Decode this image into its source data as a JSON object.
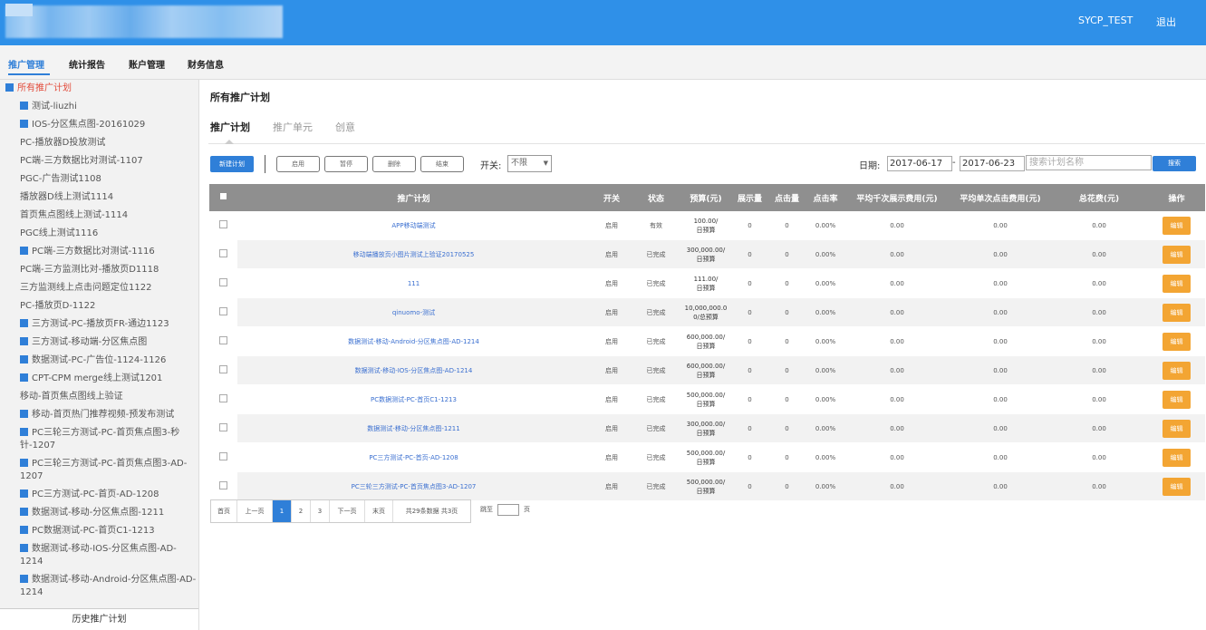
{
  "header": {
    "user": "SYCP_TEST",
    "logout": "退出"
  },
  "nav": [
    "推广管理",
    "统计报告",
    "账户管理",
    "财务信息"
  ],
  "sidebar": {
    "root": "所有推广计划",
    "items": [
      {
        "label": "测试-liuzhi",
        "icon": true
      },
      {
        "label": "IOS-分区焦点图-20161029",
        "icon": true
      },
      {
        "label": "PC-播放器D投放测试",
        "icon": false
      },
      {
        "label": "PC端-三方数据比对测试-1107",
        "icon": false
      },
      {
        "label": "PGC-广告测试1108",
        "icon": false
      },
      {
        "label": "播放器D线上测试1114",
        "icon": false
      },
      {
        "label": "首页焦点图线上测试-1114",
        "icon": false
      },
      {
        "label": "PGC线上测试1116",
        "icon": false
      },
      {
        "label": "PC端-三方数据比对测试-1116",
        "icon": true
      },
      {
        "label": "PC端-三方监测比对-播放页D1118",
        "icon": false
      },
      {
        "label": "三方监测线上点击问题定位1122",
        "icon": false
      },
      {
        "label": "PC-播放页D-1122",
        "icon": false
      },
      {
        "label": "三方测试-PC-播放页FR-通边1123",
        "icon": true
      },
      {
        "label": "三方测试-移动端-分区焦点图",
        "icon": true
      },
      {
        "label": "数据测试-PC-广告位-1124-1126",
        "icon": true
      },
      {
        "label": "CPT-CPM merge线上测试1201",
        "icon": true
      },
      {
        "label": "移动-首页焦点图线上验证",
        "icon": false
      },
      {
        "label": "移动-首页热门推荐视频-预发布测试",
        "icon": true
      },
      {
        "label": "PC三轮三方测试-PC-首页焦点图3-秒针-1207",
        "icon": true
      },
      {
        "label": "PC三轮三方测试-PC-首页焦点图3-AD-1207",
        "icon": true
      },
      {
        "label": "PC三方测试-PC-首页-AD-1208",
        "icon": true
      },
      {
        "label": "数据测试-移动-分区焦点图-1211",
        "icon": true
      },
      {
        "label": "PC数据测试-PC-首页C1-1213",
        "icon": true
      },
      {
        "label": "数据测试-移动-IOS-分区焦点图-AD-1214",
        "icon": true
      },
      {
        "label": "数据测试-移动-Android-分区焦点图-AD-1214",
        "icon": true
      }
    ],
    "history": "历史推广计划"
  },
  "main": {
    "title": "所有推广计划",
    "tabs": [
      "推广计划",
      "推广单元",
      "创意"
    ],
    "toolbar": {
      "new": "新建计划",
      "actions": [
        "启用",
        "暂停",
        "删除",
        "结束"
      ],
      "switch_label": "开关:",
      "switch_value": "不限",
      "date_label": "日期:",
      "date_from": "2017-06-17",
      "date_sep": "-",
      "date_to": "2017-06-23",
      "search_placeholder": "搜索计划名称",
      "search_btn": "搜索"
    },
    "columns": [
      "推广计划",
      "开关",
      "状态",
      "预算(元)",
      "展示量",
      "点击量",
      "点击率",
      "平均千次展示费用(元)",
      "平均单次点击费用(元)",
      "总花费(元)",
      "操作"
    ],
    "rows": [
      {
        "name": "APP移动端测试",
        "switch": "启用",
        "status": "有效",
        "budget": "100.00/",
        "budget_unit": "日预算",
        "impr": "0",
        "click": "0",
        "ctr": "0.00%",
        "cpm": "0.00",
        "cpc": "0.00",
        "cost": "0.00",
        "op": "编辑"
      },
      {
        "name": "移动端播放页小图片测试上验证20170525",
        "switch": "启用",
        "status": "已完成",
        "budget": "300,000.00/",
        "budget_unit": "日预算",
        "impr": "0",
        "click": "0",
        "ctr": "0.00%",
        "cpm": "0.00",
        "cpc": "0.00",
        "cost": "0.00",
        "op": "编辑"
      },
      {
        "name": "111",
        "switch": "启用",
        "status": "已完成",
        "budget": "111.00/",
        "budget_unit": "日预算",
        "impr": "0",
        "click": "0",
        "ctr": "0.00%",
        "cpm": "0.00",
        "cpc": "0.00",
        "cost": "0.00",
        "op": "编辑"
      },
      {
        "name": "qinuomo-测试",
        "switch": "启用",
        "status": "已完成",
        "budget": "10,000,000.0",
        "budget_unit": "0/总预算",
        "impr": "0",
        "click": "0",
        "ctr": "0.00%",
        "cpm": "0.00",
        "cpc": "0.00",
        "cost": "0.00",
        "op": "编辑"
      },
      {
        "name": "数据测试-移动-Android-分区焦点图-AD-1214",
        "switch": "启用",
        "status": "已完成",
        "budget": "600,000.00/",
        "budget_unit": "日预算",
        "impr": "0",
        "click": "0",
        "ctr": "0.00%",
        "cpm": "0.00",
        "cpc": "0.00",
        "cost": "0.00",
        "op": "编辑"
      },
      {
        "name": "数据测试-移动-IOS-分区焦点图-AD-1214",
        "switch": "启用",
        "status": "已完成",
        "budget": "600,000.00/",
        "budget_unit": "日预算",
        "impr": "0",
        "click": "0",
        "ctr": "0.00%",
        "cpm": "0.00",
        "cpc": "0.00",
        "cost": "0.00",
        "op": "编辑"
      },
      {
        "name": "PC数据测试-PC-首页C1-1213",
        "switch": "启用",
        "status": "已完成",
        "budget": "500,000.00/",
        "budget_unit": "日预算",
        "impr": "0",
        "click": "0",
        "ctr": "0.00%",
        "cpm": "0.00",
        "cpc": "0.00",
        "cost": "0.00",
        "op": "编辑"
      },
      {
        "name": "数据测试-移动-分区焦点图-1211",
        "switch": "启用",
        "status": "已完成",
        "budget": "300,000.00/",
        "budget_unit": "日预算",
        "impr": "0",
        "click": "0",
        "ctr": "0.00%",
        "cpm": "0.00",
        "cpc": "0.00",
        "cost": "0.00",
        "op": "编辑"
      },
      {
        "name": "PC三方测试-PC-首页-AD-1208",
        "switch": "启用",
        "status": "已完成",
        "budget": "500,000.00/",
        "budget_unit": "日预算",
        "impr": "0",
        "click": "0",
        "ctr": "0.00%",
        "cpm": "0.00",
        "cpc": "0.00",
        "cost": "0.00",
        "op": "编辑"
      },
      {
        "name": "PC三轮三方测试-PC-首页焦点图3-AD-1207",
        "switch": "启用",
        "status": "已完成",
        "budget": "500,000.00/",
        "budget_unit": "日预算",
        "impr": "0",
        "click": "0",
        "ctr": "0.00%",
        "cpm": "0.00",
        "cpc": "0.00",
        "cost": "0.00",
        "op": "编辑"
      }
    ],
    "pager": {
      "first": "首页",
      "prev": "上一页",
      "pages": [
        "1",
        "2",
        "3"
      ],
      "next": "下一页",
      "last": "末页",
      "summary": "共29条数据 共3页",
      "goto": "跳至",
      "goto_unit": "页"
    }
  }
}
